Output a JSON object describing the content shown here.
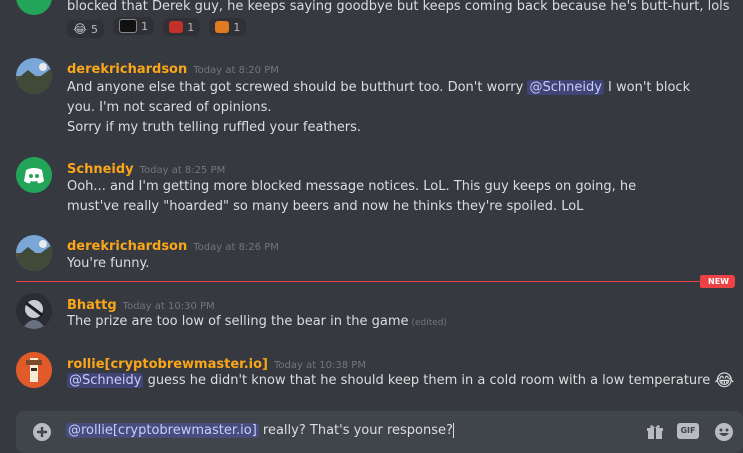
{
  "messages": [
    {
      "id": "m0",
      "text": "blocked that Derek guy, he keeps saying goodbye but keeps coming back because he's butt-hurt, lols",
      "reactions": [
        {
          "icon": "joy-emoji",
          "count": "5"
        },
        {
          "icon": "fact-emoji",
          "count": "1"
        },
        {
          "icon": "red-emoji",
          "count": "1"
        },
        {
          "icon": "sticker-emoji",
          "count": "1"
        }
      ]
    },
    {
      "id": "m1",
      "author": "derekrichardson",
      "author_color": "#faa61a",
      "timestamp": "Today at 8:20 PM",
      "avatar": "landscape-avatar",
      "lines": [
        {
          "pre": "And anyone else that got screwed should be butthurt too. Don't worry ",
          "mention": "@Schneidy",
          "post": " I won't block you. I'm not scared of opinions."
        },
        {
          "text": "Sorry if my truth telling ruffled your feathers."
        }
      ]
    },
    {
      "id": "m2",
      "author": "Schneidy",
      "author_color": "#faa61a",
      "timestamp": "Today at 8:25 PM",
      "avatar": "discord-avatar",
      "text": "Ooh... and I'm getting more blocked message notices. LoL. This guy keeps on going, he must've really \"hoarded\" so many beers and now he thinks they're spoiled. LoL"
    },
    {
      "id": "m3",
      "author": "derekrichardson",
      "author_color": "#faa61a",
      "timestamp": "Today at 8:26 PM",
      "avatar": "landscape-avatar",
      "text": "You're funny."
    },
    {
      "id": "m4",
      "author": "Bhattg",
      "author_color": "#faa61a",
      "timestamp": "Today at 10:30 PM",
      "avatar": "character-avatar",
      "text": "The prize are too low of selling the bear in the game",
      "edited": "(edited)"
    },
    {
      "id": "m5",
      "author": "rollie[cryptobrewmaster.io]",
      "author_color": "#faa61a",
      "timestamp": "Today at 10:38 PM",
      "avatar": "totem-avatar",
      "mention": "@Schneidy",
      "text": " guess he didn't know that he should keep them in a cold room with a low temperature",
      "emoji": "😂"
    }
  ],
  "new_divider": {
    "label": "NEW"
  },
  "composer": {
    "mention": "@rollie[cryptobrewmaster.io]",
    "text": " really? That's your response?",
    "icons": [
      "add-icon",
      "gift-icon",
      "gif-icon",
      "emoji-picker-icon"
    ],
    "gif_label": "GIF"
  },
  "colors": {
    "background": "#36393f",
    "input": "#40444b",
    "username": "#faa61a",
    "new_marker": "#ed4245",
    "mention_text": "#c9cdfb"
  }
}
